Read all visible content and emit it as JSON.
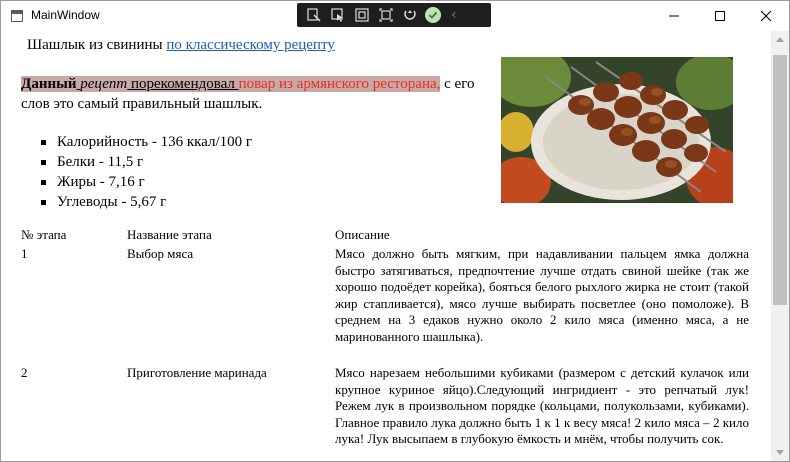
{
  "window": {
    "title": "MainWindow",
    "controls": {
      "minimize": "minimize",
      "maximize": "maximize",
      "close": "close"
    }
  },
  "debug_toolbar": {
    "icons": [
      "live-visual-tree-icon",
      "select-element-icon",
      "display-layout-adorners-icon",
      "track-focus-icon",
      "hot-reload-icon",
      "check-icon"
    ]
  },
  "recipe": {
    "heading_prefix": "Шашлык из свинины",
    "heading_link": "по классическому рецепту",
    "intro": {
      "bold": "Данный",
      "italic": "рецепт",
      "underlined": "порекомендовал",
      "red": "повар из армянского ресторана,",
      "rest": " с его слов это самый правильный шашлык."
    },
    "nutrition": [
      "Калорийность - 136 ккал/100 г",
      "Белки - 11,5 г",
      "Жиры - 7,16 г",
      "Углеводы - 5,67 г"
    ],
    "photo_alt": "шашлык"
  },
  "steps_table": {
    "headers": {
      "num": "№ этапа",
      "name": "Название этапа",
      "desc": "Описание"
    },
    "rows": [
      {
        "num": "1",
        "name": "Выбор мяса",
        "desc": "Мясо должно быть мягким, при надавливании пальцем ямка должна быстро затягиваться, предпочтение лучше отдать свиной шейке (так же хорошо подоёдет корейка), бояться белого рыхлого жирка не стоит (такой жир стапливается), мясо лучше выбирать посветлее (оно помоложе). В среднем на 3 едаков нужно около 2 кило мяса (именно мяса, а не маринованного шашлыка)."
      },
      {
        "num": "2",
        "name": "Приготовление маринада",
        "desc": "Мясо нарезаем небольшими кубиками (размером с детский кулачок или крупное куриное яйцо).Следующий ингридиент - это репчатый лук! Режем лук в произвольном порядке (кольцами, полукользами, кубиками). Главное правило лука должно быть 1 к 1 к весу мяса! 2 кило мяса – 2 кило лука! Лук высыпаем в глубокую ёмкость и мнём, чтобы получить сок."
      }
    ]
  }
}
